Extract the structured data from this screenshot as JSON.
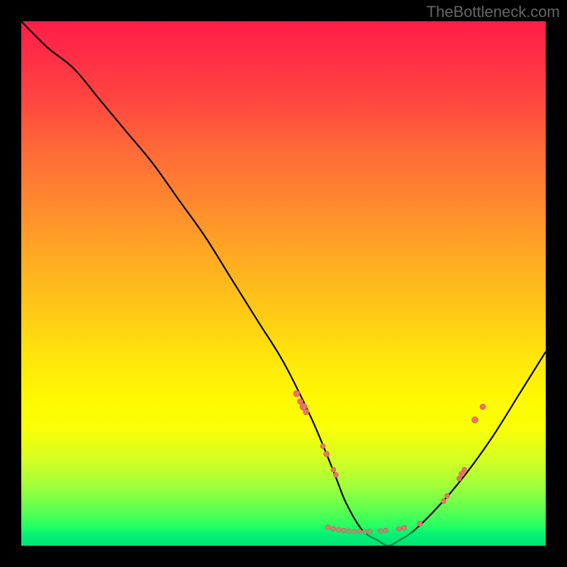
{
  "watermark": "TheBottleneck.com",
  "chart_data": {
    "type": "line",
    "title": "",
    "xlabel": "",
    "ylabel": "",
    "xlim": [
      0,
      100
    ],
    "ylim": [
      0,
      100
    ],
    "curve": {
      "x": [
        0,
        5,
        10,
        15,
        20,
        25,
        30,
        35,
        40,
        45,
        50,
        55,
        58,
        60,
        62,
        65,
        68,
        70,
        72,
        75,
        80,
        85,
        90,
        95,
        100
      ],
      "y": [
        100,
        95,
        91,
        85,
        79,
        73,
        66,
        59,
        51,
        43,
        35,
        25,
        18,
        13,
        8,
        3,
        1,
        0,
        1,
        3,
        8,
        14,
        21,
        29,
        37
      ]
    },
    "markers": [
      {
        "x": 52.5,
        "y": 29,
        "r": 4.5
      },
      {
        "x": 53.2,
        "y": 27.5,
        "r": 4
      },
      {
        "x": 53.8,
        "y": 26.5,
        "r": 5
      },
      {
        "x": 54.3,
        "y": 25.5,
        "r": 4
      },
      {
        "x": 57.5,
        "y": 19,
        "r": 3.5
      },
      {
        "x": 58.2,
        "y": 17.5,
        "r": 4
      },
      {
        "x": 59.5,
        "y": 14.5,
        "r": 3.5
      },
      {
        "x": 60.0,
        "y": 13.5,
        "r": 3.5
      },
      {
        "x": 58.5,
        "y": 3.5,
        "r": 3.5
      },
      {
        "x": 59.5,
        "y": 3.2,
        "r": 3.5
      },
      {
        "x": 60.5,
        "y": 3.0,
        "r": 3.5
      },
      {
        "x": 61.5,
        "y": 2.9,
        "r": 3.5
      },
      {
        "x": 62.5,
        "y": 2.8,
        "r": 3.5
      },
      {
        "x": 63.5,
        "y": 2.7,
        "r": 3.5
      },
      {
        "x": 64.5,
        "y": 2.7,
        "r": 3.5
      },
      {
        "x": 65.5,
        "y": 2.7,
        "r": 3.5
      },
      {
        "x": 66.5,
        "y": 2.7,
        "r": 3.5
      },
      {
        "x": 68.5,
        "y": 2.8,
        "r": 3.5
      },
      {
        "x": 69.5,
        "y": 2.9,
        "r": 3.5
      },
      {
        "x": 72.0,
        "y": 3.2,
        "r": 3.5
      },
      {
        "x": 73.0,
        "y": 3.4,
        "r": 3.5
      },
      {
        "x": 76.0,
        "y": 4.2,
        "r": 3.5
      },
      {
        "x": 80.5,
        "y": 8.5,
        "r": 3.5
      },
      {
        "x": 81.2,
        "y": 9.5,
        "r": 3.5
      },
      {
        "x": 83.5,
        "y": 12.8,
        "r": 3.5
      },
      {
        "x": 84.0,
        "y": 13.7,
        "r": 4
      },
      {
        "x": 84.5,
        "y": 14.5,
        "r": 3.5
      },
      {
        "x": 86.5,
        "y": 24.0,
        "r": 4.5
      },
      {
        "x": 88.0,
        "y": 26.5,
        "r": 4
      }
    ],
    "colors": {
      "curve": "#000000",
      "marker_fill": "#e8746a",
      "marker_stroke": "#c85a52"
    }
  }
}
